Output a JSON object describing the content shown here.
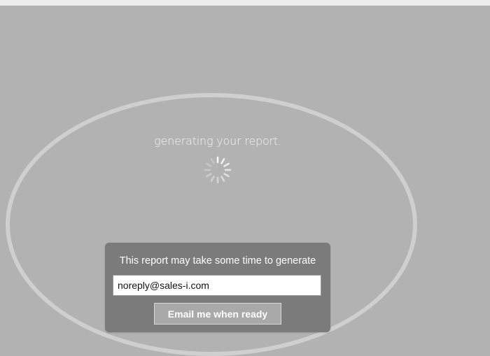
{
  "loading": {
    "message": "generating your report."
  },
  "dialog": {
    "message": "This report may take some time to generate",
    "email_value": "noreply@sales-i.com",
    "button_label": "Email me when ready"
  },
  "icons": {
    "spinner": "loading-spinner-icon"
  },
  "colors": {
    "background": "#b2b2b2",
    "ring": "#cfcfcf",
    "dialog": "#7b7b7b",
    "button": "#a9a9a9"
  }
}
